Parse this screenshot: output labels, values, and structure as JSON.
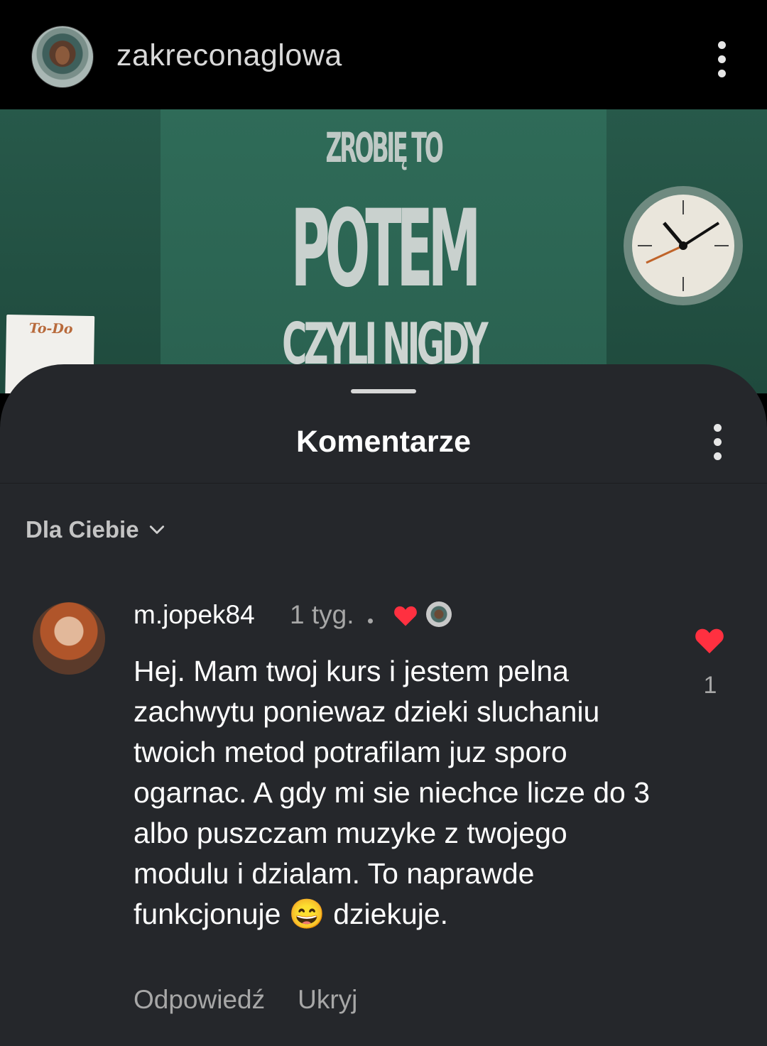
{
  "header": {
    "account_name": "zakreconaglowa",
    "more_icon": "more-vertical-icon"
  },
  "post_image": {
    "title_line1": "ZROBIĘ TO",
    "title_line2": "POTEM",
    "title_line3": "CZYLI NIGDY",
    "todo_label": "To-Do"
  },
  "comments_sheet": {
    "title": "Komentarze",
    "sort_label": "Dla Ciebie",
    "comment": {
      "username": "m.jopek84",
      "time_ago": "1 tyg.",
      "text": "Hej. Mam twoj kurs i jestem pelna zachwytu poniewaz dzieki sluchaniu twoich metod potrafilam juz sporo ogarnac. A gdy mi sie niechce licze do 3 albo puszczam muzyke z twojego modulu i dzialam. To naprawde funkcjonuje 😄 dziekuje.",
      "like_count": "1",
      "reply_label": "Odpowiedź",
      "hide_label": "Ukryj"
    }
  },
  "colors": {
    "like_red": "#ff3040",
    "sheet_bg": "#25272b",
    "post_green": "#2f6b58"
  }
}
